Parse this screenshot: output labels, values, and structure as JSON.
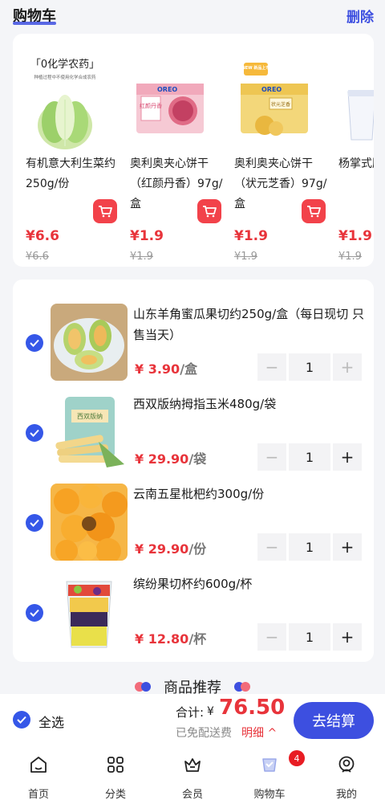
{
  "header": {
    "title": "购物车",
    "delete_label": "删除"
  },
  "recommendations": [
    {
      "name": "有机意大利生菜约250g/份",
      "price": "¥6.6",
      "old_price": "¥6.6",
      "image_text": "「0化学农药」",
      "image_subtext": "种植过程中不使用化学合成农药"
    },
    {
      "name": "奥利奥夹心饼干（红颜丹香）97g/盒",
      "price": "¥1.9",
      "old_price": "¥1.9",
      "image_text": "红颜丹香"
    },
    {
      "name": "奥利奥夹心饼干（状元芝香）97g/盒",
      "price": "¥1.9",
      "old_price": "¥1.9",
      "image_text": "状元芝香",
      "badge": "NEW 新品上市"
    },
    {
      "name": "杨掌式肥",
      "price": "¥1.9",
      "old_price": "¥1.9"
    }
  ],
  "cart_items": [
    {
      "name": "山东羊角蜜瓜果切约250g/盒（每日现切 只售当天）",
      "price": "¥ 3.90",
      "unit": "/盒",
      "qty": "1"
    },
    {
      "name": "西双版纳拇指玉米480g/袋",
      "price": "¥ 29.90",
      "unit": "/袋",
      "qty": "1",
      "image_text": "西双版纳"
    },
    {
      "name": "云南五星枇杷约300g/份",
      "price": "¥ 29.90",
      "unit": "/份",
      "qty": "1"
    },
    {
      "name": "缤纷果切杯约600g/杯",
      "price": "¥ 12.80",
      "unit": "/杯",
      "qty": "1"
    }
  ],
  "recommend_section": {
    "title": "商品推荐"
  },
  "checkout": {
    "select_all": "全选",
    "total_label": "合计:",
    "currency": "¥",
    "total": "76.50",
    "shipping": "已免配送费",
    "detail": "明细 ^",
    "pay_label": "去结算"
  },
  "tabbar": {
    "items": [
      {
        "label": "首页",
        "icon": "home-icon"
      },
      {
        "label": "分类",
        "icon": "category-icon"
      },
      {
        "label": "会员",
        "icon": "crown-icon"
      },
      {
        "label": "购物车",
        "icon": "cart-icon"
      },
      {
        "label": "我的",
        "icon": "profile-icon"
      }
    ],
    "cart_badge": "4"
  },
  "colors": {
    "accent": "#3d4fe0",
    "price_red": "#e8343b",
    "check_blue": "#3557e8"
  }
}
